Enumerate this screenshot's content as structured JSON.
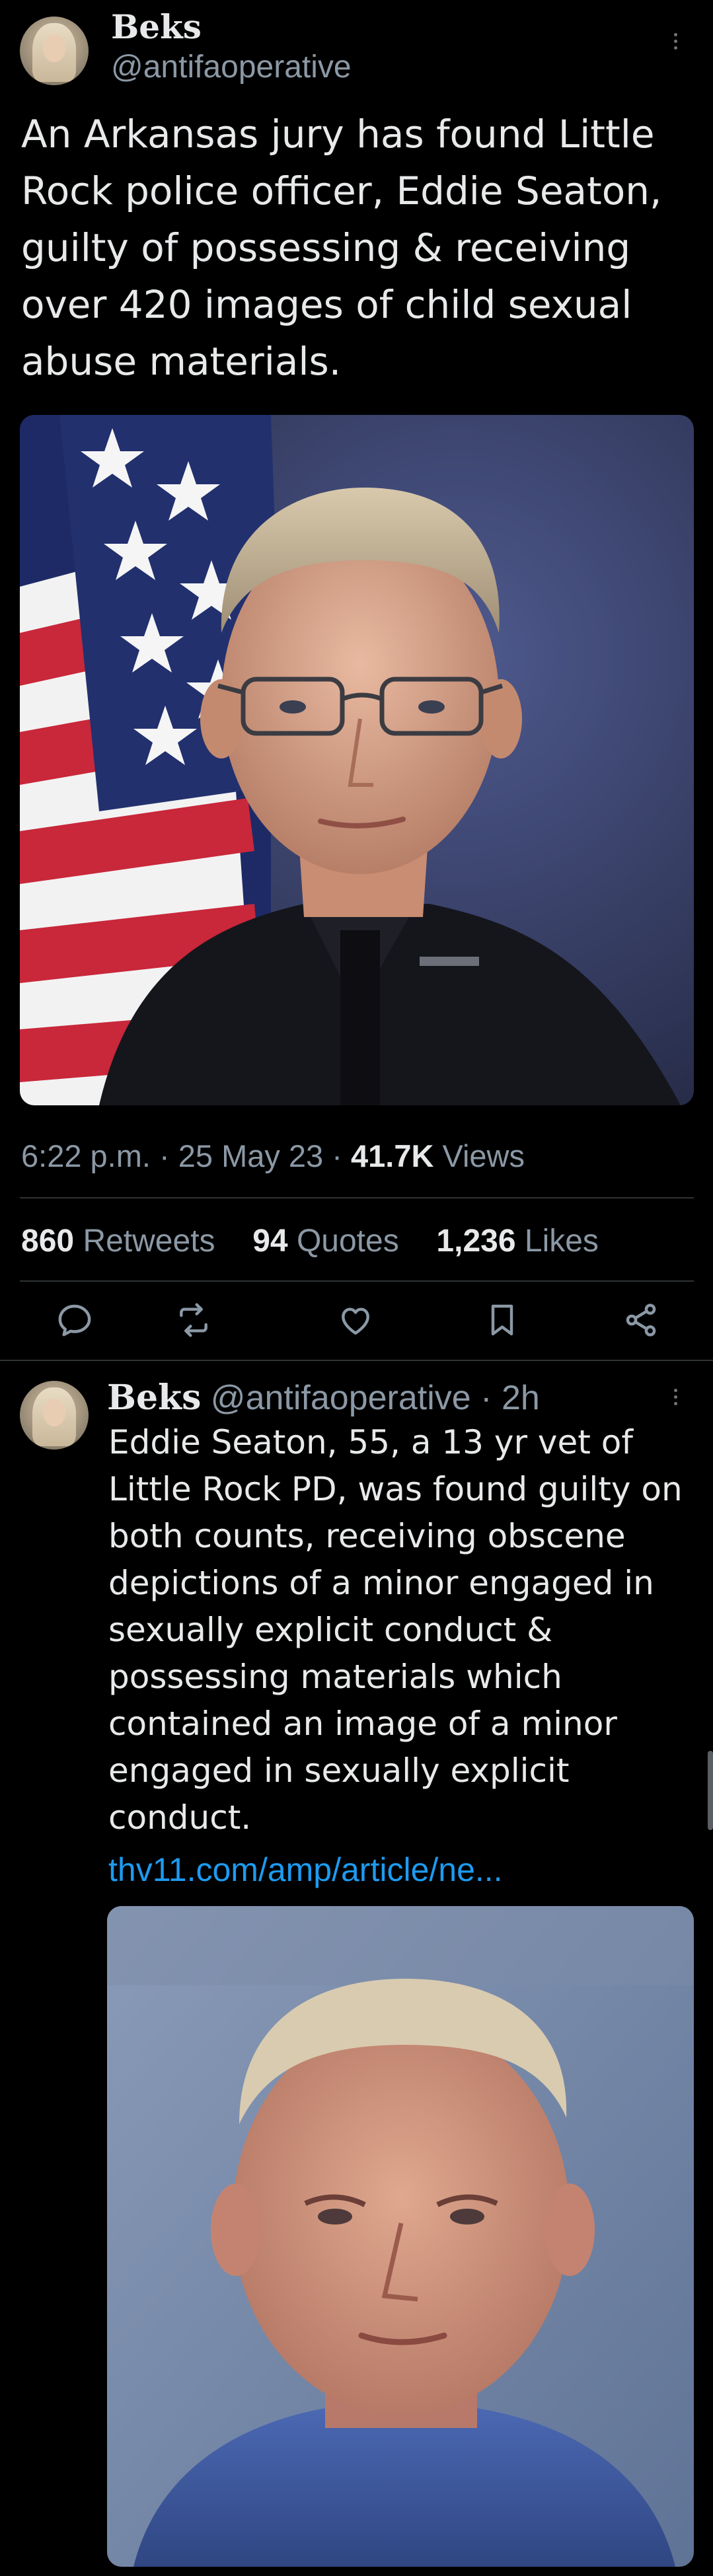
{
  "tweet": {
    "author": {
      "display_name": "Beks",
      "handle": "@antifaoperative",
      "avatar_icon": "avatar-portrait"
    },
    "text": "An Arkansas jury has found Little Rock police officer, Eddie Seaton, guilty of possessing & receiving over 420 images of child sexual abuse materials.",
    "image_alt": "Official portrait of police officer in uniform with American flag",
    "time": "6:22 p.m.",
    "date": "25 May 23",
    "views_count": "41.7K",
    "views_label": "Views",
    "retweets_count": "860",
    "retweets_label": "Retweets",
    "quotes_count": "94",
    "quotes_label": "Quotes",
    "likes_count": "1,236",
    "likes_label": "Likes",
    "actions": [
      "reply-icon",
      "retweet-icon",
      "like-icon",
      "bookmark-icon",
      "share-icon"
    ]
  },
  "reply": {
    "author": {
      "display_name": "Beks",
      "handle": "@antifaoperative",
      "time_ago": "2h"
    },
    "text": "Eddie Seaton, 55, a 13 yr vet of Little Rock PD, was found guilty on both counts, receiving obscene depictions of a minor engaged in sexually explicit conduct & possessing materials which contained an image of a minor engaged in sexually explicit conduct.",
    "link_text": "thv11.com/amp/article/ne...",
    "image_alt": "Booking photo of a man in a blue shirt"
  },
  "colors": {
    "background": "#000000",
    "text": "#e7e9ea",
    "secondary": "#8b98a5",
    "link": "#1d9bf0",
    "divider": "#2f3336"
  }
}
